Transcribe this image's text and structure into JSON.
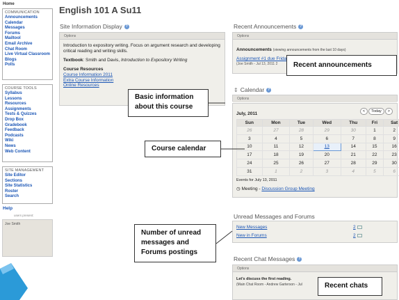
{
  "home_label": "Home",
  "communication": {
    "heading": "COMMUNICATION",
    "items": [
      "Announcements",
      "Calendar",
      "Messages",
      "Forums",
      "Mailtool",
      "Email Archive",
      "Chat Room",
      "Live Virtual Classroom",
      "Blogs",
      "Polls"
    ]
  },
  "course_tools": {
    "heading": "COURSE TOOLS",
    "items": [
      "Syllabus",
      "Lessons",
      "Resources",
      "Assignments",
      "Tests & Quizzes",
      "Drop Box",
      "Gradebook",
      "Feedback",
      "Podcasts",
      "Wiki",
      "News",
      "Web Content"
    ]
  },
  "site_management": {
    "heading": "SITE MANAGEMENT",
    "items": [
      "Site Editor",
      "Sections",
      "Site Statistics",
      "Roster",
      "Search"
    ]
  },
  "help_label": "Help",
  "users_present": {
    "label": "users present:",
    "user": "Joe Smith"
  },
  "site_title": "English 101 A Su11",
  "site_info": {
    "title": "Site Information Display",
    "options": "Options",
    "description": "Introduction to expository writing. Focus on argument research and developing critical reading and writing skills.",
    "textbook_label": "Textbook",
    "textbook_authors": ": Smith and Davis, ",
    "textbook_title": "Introduction to Expository Writing",
    "resources_heading": "Course Resources",
    "resource_links": [
      "Course Information 2011",
      "Extra Course Information",
      "Online Resources"
    ]
  },
  "announcements": {
    "title": "Recent Announcements",
    "options": "Options",
    "label": "Announcements",
    "note": "(viewing announcements from the last 10 days)",
    "item_title": "Assignment #1 due Frida",
    "item_meta": "(Joe Smith - Jul 13, 2011 2"
  },
  "calendar": {
    "title": "Calendar",
    "options": "Options",
    "month": "July, 2011",
    "today_label": "Today",
    "prev": "<",
    "next": ">",
    "weekdays": [
      "Sun",
      "Mon",
      "Tue",
      "Wed",
      "Thu",
      "Fri",
      "Sat"
    ],
    "weeks": [
      [
        [
          "26",
          1
        ],
        [
          "27",
          1
        ],
        [
          "28",
          1
        ],
        [
          "29",
          1
        ],
        [
          "30",
          1
        ],
        [
          "1",
          0
        ],
        [
          "2",
          0
        ]
      ],
      [
        [
          "3",
          0
        ],
        [
          "4",
          0
        ],
        [
          "5",
          0
        ],
        [
          "6",
          0
        ],
        [
          "7",
          0
        ],
        [
          "8",
          0
        ],
        [
          "9",
          0
        ]
      ],
      [
        [
          "10",
          0
        ],
        [
          "11",
          0
        ],
        [
          "12",
          0
        ],
        [
          "13",
          2
        ],
        [
          "14",
          0
        ],
        [
          "15",
          0
        ],
        [
          "16",
          0
        ]
      ],
      [
        [
          "17",
          0
        ],
        [
          "18",
          0
        ],
        [
          "19",
          0
        ],
        [
          "20",
          0
        ],
        [
          "21",
          0
        ],
        [
          "22",
          0
        ],
        [
          "23",
          0
        ]
      ],
      [
        [
          "24",
          0
        ],
        [
          "25",
          0
        ],
        [
          "26",
          0
        ],
        [
          "27",
          0
        ],
        [
          "28",
          0
        ],
        [
          "29",
          0
        ],
        [
          "30",
          0
        ]
      ],
      [
        [
          "31",
          0
        ],
        [
          "1",
          1
        ],
        [
          "2",
          1
        ],
        [
          "3",
          1
        ],
        [
          "4",
          1
        ],
        [
          "5",
          1
        ],
        [
          "6",
          1
        ]
      ]
    ],
    "events_heading": "Events for July 13, 2011",
    "event_type": "Meeting - ",
    "event_link": "Discussion Group Meeting"
  },
  "unread": {
    "title": "Unread Messages and Forums",
    "rows": [
      {
        "label": "New Messages",
        "count": "2"
      },
      {
        "label": "New in Forums",
        "count": "2"
      }
    ]
  },
  "chat": {
    "title": "Recent Chat Messages",
    "options": "Options",
    "message": "Let's discuss the first reading.",
    "meta": "(Main Chat Room - Andrew Garterson - Jul"
  },
  "callouts": {
    "recent_announcements": "Recent announcements",
    "basic_info": "Basic information about this course",
    "course_calendar": "Course calendar",
    "unread": "Number of unread messages and Forums postings",
    "recent_chats": "Recent chats"
  },
  "colors": {
    "link": "#1a55b5",
    "panel_bg": "#f0efea",
    "options_bg": "#e4e2dd",
    "help_icon": "#6a98d4"
  }
}
